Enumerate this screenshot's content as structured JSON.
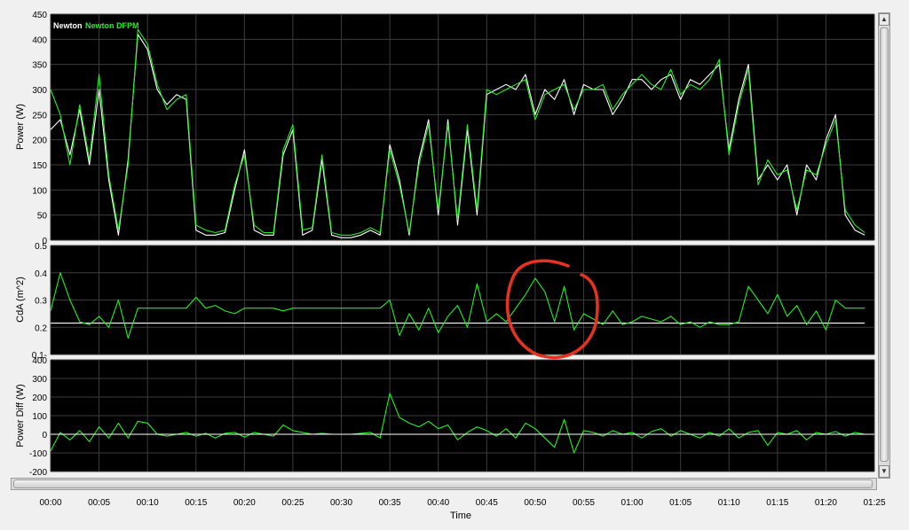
{
  "colors": {
    "plot_bg": "#000000",
    "grid": "#3c3c3c",
    "series_newton": "#ffffff",
    "series_dfpm": "#22ee22",
    "annotation": "#e8321f",
    "frame": "#f0f0f0"
  },
  "legend": {
    "newton_label": "Newton",
    "dfpm_label": "Newton DFPM"
  },
  "x_axis": {
    "title": "Time",
    "ticks": [
      "00:00",
      "00:05",
      "00:10",
      "00:15",
      "00:20",
      "00:25",
      "00:30",
      "00:35",
      "00:40",
      "00:45",
      "00:50",
      "00:55",
      "01:00",
      "01:05",
      "01:10",
      "01:15",
      "01:20",
      "01:25"
    ]
  },
  "chart_data": [
    {
      "type": "line",
      "ylabel": "Power (W)",
      "ylim": [
        0,
        450
      ],
      "yticks": [
        "450",
        "400",
        "350",
        "300",
        "250",
        "200",
        "150",
        "100",
        "50",
        "0"
      ],
      "grid": true,
      "legend_position": "top-left",
      "x_unit": "minutes",
      "series": [
        {
          "name": "Newton",
          "x": [
            0,
            1,
            2,
            3,
            4,
            5,
            6,
            7,
            8,
            9,
            10,
            11,
            12,
            13,
            14,
            15,
            16,
            17,
            18,
            19,
            20,
            21,
            22,
            23,
            24,
            25,
            26,
            27,
            28,
            29,
            30,
            31,
            32,
            33,
            34,
            35,
            36,
            37,
            38,
            39,
            40,
            41,
            42,
            43,
            44,
            45,
            46,
            47,
            48,
            49,
            50,
            51,
            52,
            53,
            54,
            55,
            56,
            57,
            58,
            59,
            60,
            61,
            62,
            63,
            64,
            65,
            66,
            67,
            68,
            69,
            70,
            71,
            72,
            73,
            74,
            75,
            76,
            77,
            78,
            79,
            80,
            81,
            82,
            83,
            84
          ],
          "values": [
            220,
            240,
            170,
            260,
            150,
            300,
            120,
            10,
            160,
            410,
            380,
            300,
            270,
            290,
            280,
            20,
            10,
            10,
            15,
            100,
            180,
            20,
            10,
            10,
            170,
            220,
            10,
            20,
            160,
            10,
            5,
            5,
            10,
            20,
            10,
            190,
            120,
            10,
            160,
            240,
            50,
            240,
            30,
            220,
            50,
            290,
            300,
            310,
            300,
            330,
            250,
            300,
            280,
            320,
            250,
            310,
            300,
            300,
            250,
            280,
            320,
            320,
            300,
            320,
            330,
            280,
            320,
            310,
            330,
            350,
            180,
            280,
            350,
            120,
            150,
            120,
            150,
            50,
            150,
            120,
            200,
            250,
            50,
            20,
            10
          ]
        },
        {
          "name": "Newton DFPM",
          "x": [
            0,
            1,
            2,
            3,
            4,
            5,
            6,
            7,
            8,
            9,
            10,
            11,
            12,
            13,
            14,
            15,
            16,
            17,
            18,
            19,
            20,
            21,
            22,
            23,
            24,
            25,
            26,
            27,
            28,
            29,
            30,
            31,
            32,
            33,
            34,
            35,
            36,
            37,
            38,
            39,
            40,
            41,
            42,
            43,
            44,
            45,
            46,
            47,
            48,
            49,
            50,
            51,
            52,
            53,
            54,
            55,
            56,
            57,
            58,
            59,
            60,
            61,
            62,
            63,
            64,
            65,
            66,
            67,
            68,
            69,
            70,
            71,
            72,
            73,
            74,
            75,
            76,
            77,
            78,
            79,
            80,
            81,
            82,
            83,
            84
          ],
          "values": [
            300,
            250,
            150,
            270,
            160,
            330,
            130,
            20,
            150,
            420,
            390,
            310,
            260,
            280,
            290,
            30,
            20,
            15,
            20,
            110,
            170,
            30,
            15,
            15,
            180,
            230,
            20,
            25,
            170,
            15,
            10,
            10,
            15,
            25,
            15,
            180,
            110,
            15,
            150,
            230,
            60,
            230,
            40,
            230,
            60,
            300,
            290,
            300,
            310,
            320,
            240,
            290,
            300,
            310,
            260,
            300,
            300,
            310,
            260,
            290,
            310,
            330,
            310,
            300,
            340,
            290,
            310,
            300,
            320,
            360,
            170,
            270,
            340,
            110,
            160,
            130,
            140,
            60,
            140,
            130,
            190,
            240,
            60,
            30,
            15
          ]
        }
      ]
    },
    {
      "type": "line",
      "ylabel": "CdA (m^2)",
      "ylim": [
        0.1,
        0.5
      ],
      "yticks": [
        "0.5",
        "0.4",
        "0.3",
        "0.2",
        "0.1-"
      ],
      "grid": true,
      "x_unit": "minutes",
      "series": [
        {
          "name": "",
          "x": [
            0,
            2,
            4,
            6,
            8,
            10,
            12,
            14,
            16,
            18,
            20,
            22,
            24,
            26,
            28,
            30,
            32,
            34,
            35,
            36,
            38,
            40,
            42,
            44,
            46,
            48,
            50,
            52,
            54,
            56,
            58,
            60,
            62,
            64,
            66,
            68,
            70,
            72,
            74,
            76,
            78,
            80,
            82,
            84
          ],
          "values": [
            0.215,
            0.215,
            0.215,
            0.215,
            0.215,
            0.215,
            0.215,
            0.215,
            0.215,
            0.215,
            0.215,
            0.215,
            0.215,
            0.215,
            0.215,
            0.215,
            0.215,
            0.215,
            0.215,
            0.215,
            0.215,
            0.215,
            0.215,
            0.215,
            0.215,
            0.215,
            0.215,
            0.215,
            0.215,
            0.215,
            0.215,
            0.215,
            0.215,
            0.215,
            0.215,
            0.215,
            0.215,
            0.215,
            0.215,
            0.215,
            0.215,
            0.215,
            0.215,
            0.215
          ]
        },
        {
          "name": "",
          "x": [
            0,
            1,
            2,
            3,
            4,
            5,
            6,
            7,
            8,
            9,
            10,
            11,
            12,
            13,
            14,
            15,
            16,
            17,
            18,
            19,
            20,
            21,
            22,
            23,
            24,
            25,
            26,
            27,
            28,
            29,
            30,
            31,
            32,
            33,
            34,
            35,
            36,
            37,
            38,
            39,
            40,
            41,
            42,
            43,
            44,
            45,
            46,
            47,
            48,
            49,
            50,
            51,
            52,
            53,
            54,
            55,
            56,
            57,
            58,
            59,
            60,
            61,
            62,
            63,
            64,
            65,
            66,
            67,
            68,
            69,
            70,
            71,
            72,
            73,
            74,
            75,
            76,
            77,
            78,
            79,
            80,
            81,
            82,
            83,
            84
          ],
          "values": [
            0.26,
            0.4,
            0.3,
            0.22,
            0.21,
            0.24,
            0.2,
            0.3,
            0.16,
            0.27,
            0.27,
            0.27,
            0.27,
            0.27,
            0.27,
            0.31,
            0.27,
            0.28,
            0.26,
            0.25,
            0.27,
            0.27,
            0.27,
            0.27,
            0.26,
            0.27,
            0.27,
            0.27,
            0.27,
            0.27,
            0.27,
            0.27,
            0.27,
            0.27,
            0.27,
            0.3,
            0.17,
            0.25,
            0.19,
            0.27,
            0.18,
            0.24,
            0.28,
            0.2,
            0.36,
            0.22,
            0.25,
            0.22,
            0.27,
            0.32,
            0.38,
            0.33,
            0.22,
            0.35,
            0.19,
            0.25,
            0.23,
            0.21,
            0.26,
            0.21,
            0.22,
            0.24,
            0.23,
            0.22,
            0.24,
            0.21,
            0.22,
            0.2,
            0.22,
            0.21,
            0.21,
            0.22,
            0.35,
            0.3,
            0.25,
            0.32,
            0.24,
            0.28,
            0.21,
            0.26,
            0.19,
            0.3,
            0.27,
            0.27,
            0.27
          ]
        }
      ]
    },
    {
      "type": "line",
      "ylabel": "Power Diff (W)",
      "ylim": [
        -200,
        400
      ],
      "yticks": [
        "400",
        "300",
        "200",
        "100",
        "0",
        "-100",
        "-200"
      ],
      "grid": true,
      "x_unit": "minutes",
      "series": [
        {
          "name": "",
          "x": [
            0,
            1,
            2,
            3,
            4,
            5,
            6,
            7,
            8,
            9,
            10,
            11,
            12,
            13,
            14,
            15,
            16,
            17,
            18,
            19,
            20,
            21,
            22,
            23,
            24,
            25,
            26,
            27,
            28,
            29,
            30,
            31,
            32,
            33,
            34,
            35,
            36,
            37,
            38,
            39,
            40,
            41,
            42,
            43,
            44,
            45,
            46,
            47,
            48,
            49,
            50,
            51,
            52,
            53,
            54,
            55,
            56,
            57,
            58,
            59,
            60,
            61,
            62,
            63,
            64,
            65,
            66,
            67,
            68,
            69,
            70,
            71,
            72,
            73,
            74,
            75,
            76,
            77,
            78,
            79,
            80,
            81,
            82,
            83,
            84
          ],
          "values": [
            -90,
            10,
            -30,
            20,
            -40,
            40,
            -20,
            60,
            -20,
            70,
            60,
            0,
            -10,
            0,
            10,
            -10,
            5,
            -20,
            5,
            10,
            -15,
            10,
            0,
            -10,
            50,
            20,
            10,
            0,
            5,
            0,
            0,
            0,
            5,
            10,
            -20,
            220,
            90,
            60,
            40,
            70,
            30,
            50,
            -30,
            10,
            40,
            20,
            -10,
            30,
            -20,
            60,
            30,
            -20,
            -70,
            80,
            -100,
            20,
            10,
            -10,
            20,
            0,
            10,
            -20,
            15,
            30,
            -10,
            20,
            0,
            -20,
            10,
            -10,
            30,
            -20,
            10,
            20,
            -60,
            10,
            0,
            20,
            -30,
            10,
            0,
            15,
            -10,
            10,
            0
          ]
        }
      ]
    }
  ]
}
